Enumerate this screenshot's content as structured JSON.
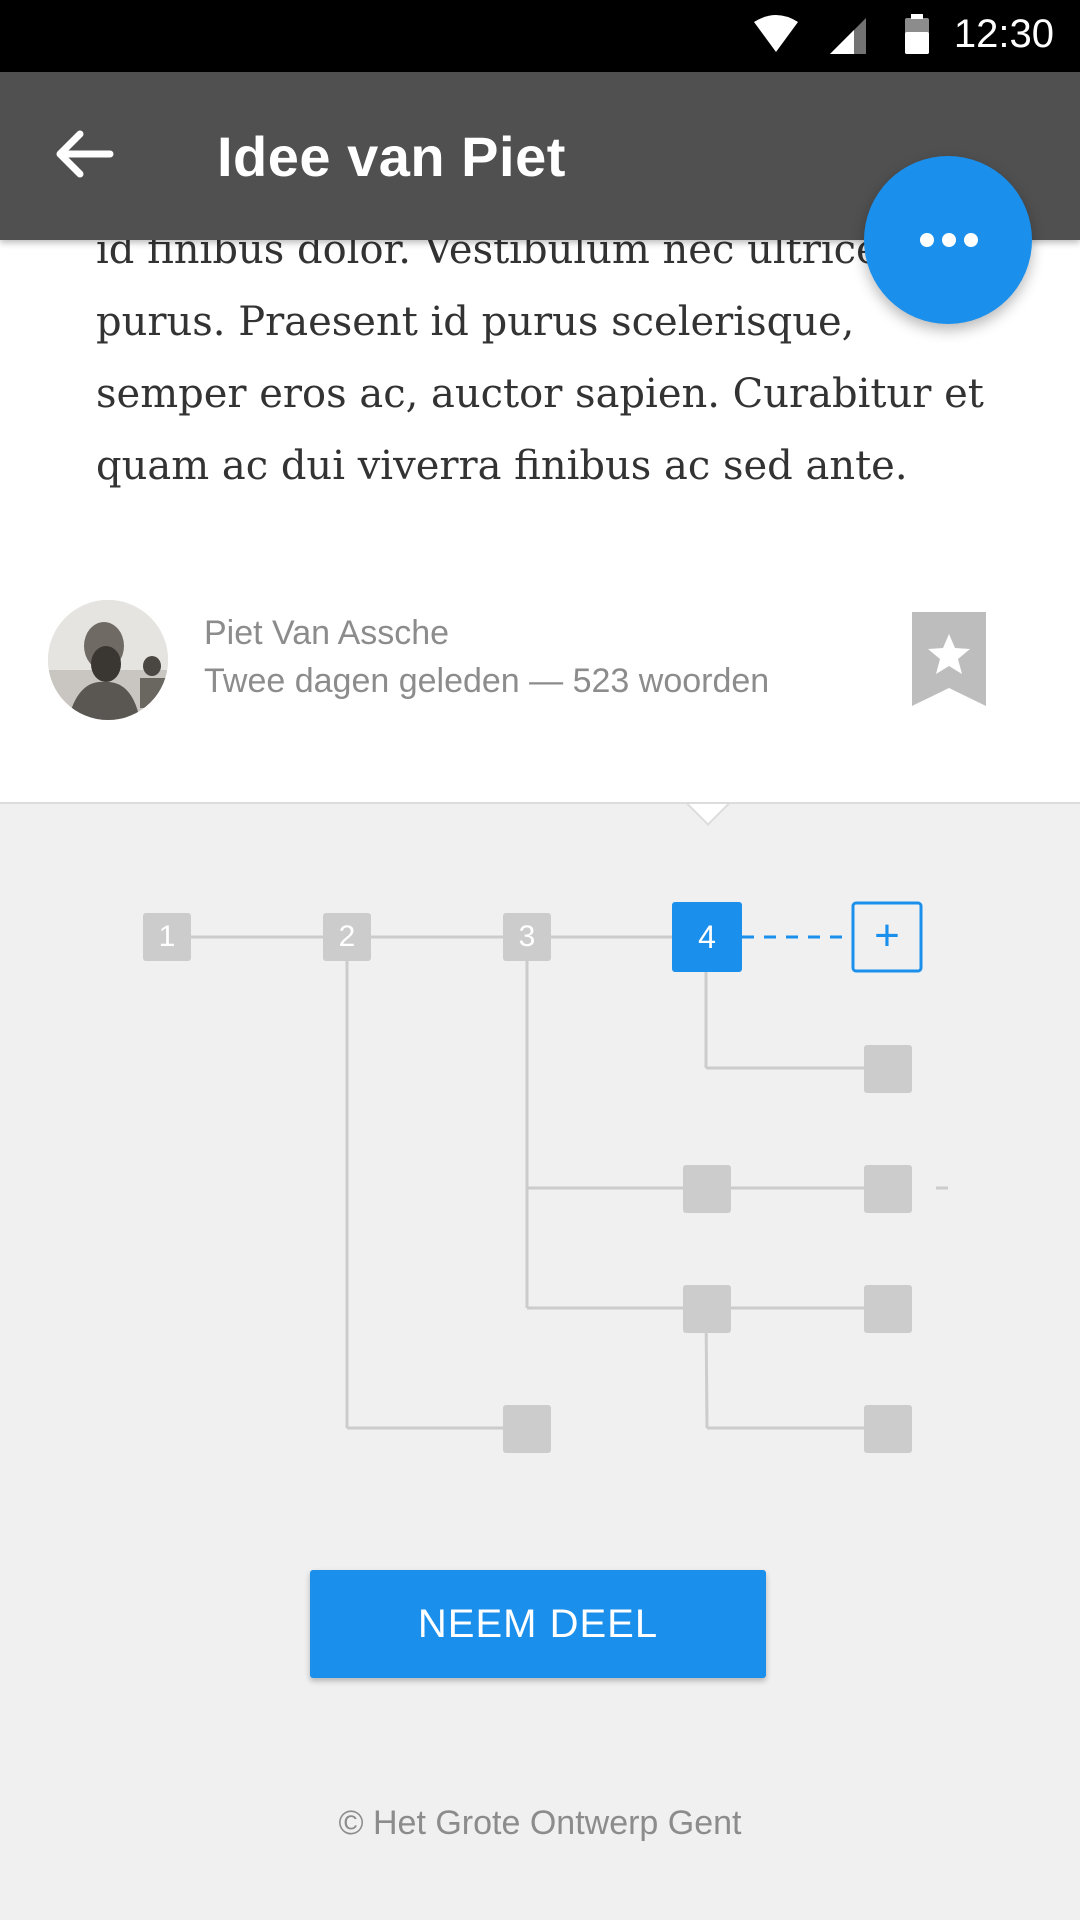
{
  "status_bar": {
    "time": "12:30",
    "icons": [
      "wifi-icon",
      "signal-icon",
      "battery-icon"
    ]
  },
  "app_bar": {
    "title": "Idee van Piet",
    "back_icon": "arrow-back-icon"
  },
  "fab": {
    "icon": "more-horizontal-icon"
  },
  "article": {
    "text": "id finibus dolor. Vestibulum nec ultrices purus. Praesent id purus scelerisque, semper eros ac, auctor sapien. Curabitur et quam ac dui viverra finibus ac sed ante."
  },
  "author": {
    "name": "Piet Van Assche",
    "meta": "Twee dagen geleden — 523 woorden",
    "bookmark_icon": "star-bookmark-icon"
  },
  "tree": {
    "nodes": [
      {
        "label": "1",
        "active": false
      },
      {
        "label": "2",
        "active": false
      },
      {
        "label": "3",
        "active": false
      },
      {
        "label": "4",
        "active": true
      }
    ],
    "add_label": "+"
  },
  "join_button": {
    "label": "NEEM DEEL"
  },
  "footer": {
    "text": "© Het Grote Ontwerp Gent"
  },
  "colors": {
    "accent": "#1a8fec",
    "app_bar": "#505050",
    "node_gray": "#cccccc",
    "text_gray": "#8c8c8c"
  }
}
